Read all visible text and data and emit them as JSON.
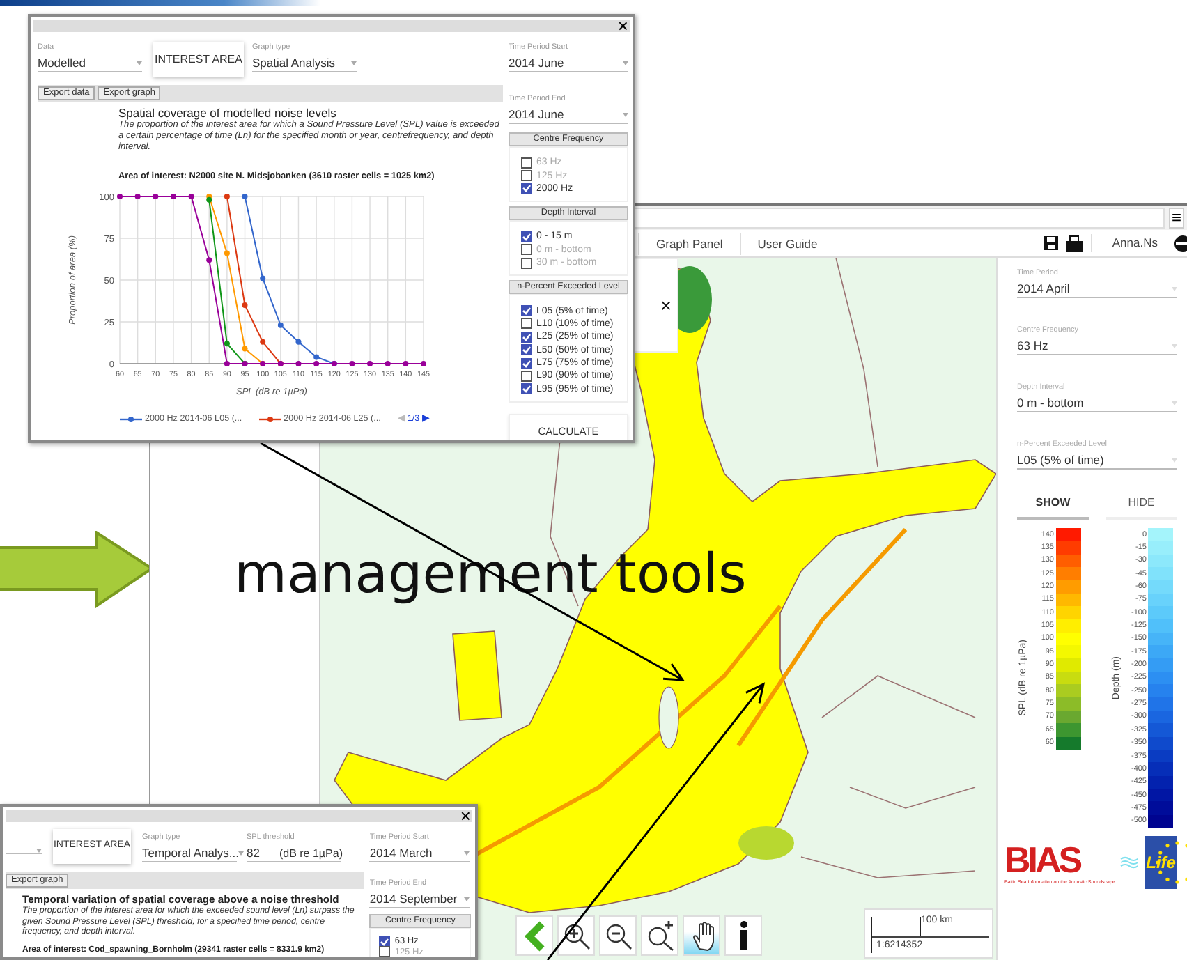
{
  "slide": {
    "headline": "management tools"
  },
  "map_app": {
    "menu_icon": "≡",
    "nav": [
      "Graph Panel",
      "User Guide"
    ],
    "user": "Anna.Ns",
    "info_panel": {
      "close": "×"
    },
    "settings": [
      {
        "label": "Time Period",
        "value": "2014 April"
      },
      {
        "label": "Centre Frequency",
        "value": "63 Hz"
      },
      {
        "label": "Depth Interval",
        "value": "0 m - bottom"
      },
      {
        "label": "n-Percent Exceeded Level",
        "value": "L05 (5% of time)"
      }
    ],
    "layer_tabs": [
      {
        "label": "SHOW",
        "selected": true
      },
      {
        "label": "HIDE",
        "selected": false
      }
    ],
    "spl_legend": {
      "axis_label": "SPL (dB re 1µPa)",
      "items": [
        {
          "label": "140",
          "color": "#ff1a00"
        },
        {
          "label": "135",
          "color": "#ff3c00"
        },
        {
          "label": "130",
          "color": "#ff5e00"
        },
        {
          "label": "125",
          "color": "#ff7e00"
        },
        {
          "label": "120",
          "color": "#ff9c00"
        },
        {
          "label": "115",
          "color": "#ffb800"
        },
        {
          "label": "110",
          "color": "#ffd400"
        },
        {
          "label": "105",
          "color": "#ffee00"
        },
        {
          "label": "100",
          "color": "#ffff00"
        },
        {
          "label": "95",
          "color": "#f4f800"
        },
        {
          "label": "90",
          "color": "#e0ea00"
        },
        {
          "label": "85",
          "color": "#c8dc10"
        },
        {
          "label": "80",
          "color": "#aacc20"
        },
        {
          "label": "75",
          "color": "#8cbc28"
        },
        {
          "label": "70",
          "color": "#6aa830"
        },
        {
          "label": "65",
          "color": "#3d9630"
        },
        {
          "label": "60",
          "color": "#157a2c"
        }
      ]
    },
    "depth_legend": {
      "axis_label": "Depth (m)",
      "items": [
        {
          "label": "0",
          "color": "#a4f4fb"
        },
        {
          "label": "-15",
          "color": "#98eefb"
        },
        {
          "label": "-30",
          "color": "#8ce8fb"
        },
        {
          "label": "-45",
          "color": "#80e2fb"
        },
        {
          "label": "-60",
          "color": "#74dafb"
        },
        {
          "label": "-75",
          "color": "#68d2fb"
        },
        {
          "label": "-100",
          "color": "#5ccafa"
        },
        {
          "label": "-125",
          "color": "#50c0fa"
        },
        {
          "label": "-150",
          "color": "#46b4f8"
        },
        {
          "label": "-175",
          "color": "#3ca8f6"
        },
        {
          "label": "-200",
          "color": "#349cf4"
        },
        {
          "label": "-225",
          "color": "#2c8ff2"
        },
        {
          "label": "-250",
          "color": "#2682ee"
        },
        {
          "label": "-275",
          "color": "#2074e8"
        },
        {
          "label": "-300",
          "color": "#1a66e0"
        },
        {
          "label": "-325",
          "color": "#1458d6"
        },
        {
          "label": "-350",
          "color": "#0f4acc"
        },
        {
          "label": "-375",
          "color": "#0a3cc2"
        },
        {
          "label": "-400",
          "color": "#062eb8"
        },
        {
          "label": "-425",
          "color": "#0322ae"
        },
        {
          "label": "-450",
          "color": "#0116a4"
        },
        {
          "label": "-475",
          "color": "#000c9a"
        },
        {
          "label": "-500",
          "color": "#000490"
        }
      ]
    },
    "map_tools": [
      {
        "kind": "back",
        "selected": false
      },
      {
        "kind": "zoom_in",
        "selected": false
      },
      {
        "kind": "zoom_out",
        "selected": false
      },
      {
        "kind": "zoom_extent",
        "selected": false
      },
      {
        "kind": "pan",
        "selected": true
      },
      {
        "kind": "info",
        "selected": false
      }
    ],
    "scale": {
      "distance": "100 km",
      "ratio": "1:6214352"
    },
    "logos": {
      "bias": "BIAS",
      "bias_subtitle": "Baltic Sea Information on the Acoustic Soundscape",
      "life": "Life"
    }
  },
  "spatial_dialog": {
    "close": "×",
    "data_field": {
      "label": "Data",
      "value": "Modelled"
    },
    "interest_button": "INTEREST AREA",
    "graph_type": {
      "label": "Graph type",
      "value": "Spatial Analysis"
    },
    "period_start": {
      "label": "Time Period Start",
      "value": "2014 June"
    },
    "period_end": {
      "label": "Time Period End",
      "value": "2014 June"
    },
    "export_buttons": [
      "Export data",
      "Export graph"
    ],
    "title": "Spatial coverage of modelled noise levels",
    "description": "The proportion of the interest area for which a Sound Pressure Level (SPL) value is exceeded a certain percentage of time (Ln) for the specified month or year, centrefrequency, and depth interval.",
    "area": "Area of interest: N2000 site N. Midsjobanken (3610 raster cells =  1025 km2)",
    "chart_data": {
      "type": "line",
      "grid": true,
      "xlim": [
        60,
        145
      ],
      "xlabel": "SPL (dB re 1µPa)",
      "ylabel": "Proportion of area (%)",
      "x": [
        60,
        65,
        70,
        75,
        80,
        85,
        90,
        95,
        100,
        105,
        110,
        115,
        120,
        125,
        130,
        135,
        140,
        145
      ],
      "xticks": [
        60,
        65,
        70,
        75,
        80,
        85,
        90,
        95,
        100,
        105,
        110,
        115,
        120,
        125,
        130,
        135,
        140,
        145
      ],
      "yticks": [
        0,
        25,
        50,
        75,
        100
      ],
      "ylim": [
        0,
        100
      ],
      "series": [
        {
          "name": "2000 Hz 2014-06 L05 (...",
          "color": "#3366cc",
          "marker": "circle",
          "values": [
            null,
            null,
            null,
            null,
            null,
            null,
            null,
            100,
            51,
            23,
            13,
            4,
            0,
            null,
            null,
            null,
            null,
            null
          ]
        },
        {
          "name": "2000 Hz 2014-06 L25 (...",
          "color": "#dc3912",
          "marker": "circle",
          "values": [
            null,
            null,
            null,
            null,
            null,
            null,
            100,
            35,
            13,
            0,
            null,
            null,
            null,
            null,
            null,
            null,
            null,
            null
          ]
        },
        {
          "color": "#ff9900",
          "marker": "circle",
          "values": [
            null,
            null,
            null,
            null,
            null,
            100,
            66,
            9,
            0,
            null,
            null,
            null,
            null,
            null,
            null,
            null,
            null,
            null
          ]
        },
        {
          "color": "#109618",
          "marker": "circle",
          "values": [
            null,
            null,
            null,
            null,
            null,
            98,
            12,
            0,
            null,
            null,
            null,
            null,
            null,
            null,
            null,
            null,
            null,
            null
          ]
        },
        {
          "color": "#990099",
          "marker": "circle",
          "values": [
            100,
            100,
            100,
            100,
            100,
            62,
            0,
            0,
            0,
            0,
            0,
            0,
            0,
            0,
            0,
            0,
            0,
            0
          ]
        }
      ]
    },
    "legend_pager": {
      "previous": {
        "label": "◀",
        "disabled": true
      },
      "page": "1/3",
      "next": {
        "label": "▶",
        "disabled": false
      }
    },
    "groups": [
      {
        "header": "Centre Frequency",
        "options": [
          {
            "label": "63 Hz",
            "checked": false,
            "disabled": true
          },
          {
            "label": "125 Hz",
            "checked": false,
            "disabled": true
          },
          {
            "label": "2000 Hz",
            "checked": true,
            "disabled": false
          }
        ]
      },
      {
        "header": "Depth Interval",
        "options": [
          {
            "label": "0 - 15 m",
            "checked": true,
            "disabled": false
          },
          {
            "label": "0 m - bottom",
            "checked": false,
            "disabled": true
          },
          {
            "label": "30 m - bottom",
            "checked": false,
            "disabled": true
          }
        ]
      },
      {
        "header": "n-Percent Exceeded Level",
        "options": [
          {
            "label": "L05 (5% of time)",
            "checked": true,
            "disabled": false
          },
          {
            "label": "L10 (10% of time)",
            "checked": false,
            "disabled": false
          },
          {
            "label": "L25 (25% of time)",
            "checked": true,
            "disabled": false
          },
          {
            "label": "L50 (50% of time)",
            "checked": true,
            "disabled": false
          },
          {
            "label": "L75 (75% of time)",
            "checked": true,
            "disabled": false
          },
          {
            "label": "L90 (90% of time)",
            "checked": false,
            "disabled": false
          },
          {
            "label": "L95 (95% of time)",
            "checked": true,
            "disabled": false
          }
        ]
      }
    ],
    "calculate": "CALCULATE"
  },
  "temporal_dialog": {
    "close": "×",
    "interest_button": "INTEREST AREA",
    "graph_type": {
      "label": "Graph type",
      "value": "Temporal Analys..."
    },
    "threshold": {
      "label": "SPL threshold",
      "value": "82",
      "unit": "(dB re 1µPa)"
    },
    "period_start": {
      "label": "Time Period Start",
      "value": "2014 March"
    },
    "period_end": {
      "label": "Time Period End",
      "value": "2014 September"
    },
    "export_buttons": [
      "Export graph"
    ],
    "title": "Temporal variation of spatial coverage above a noise threshold",
    "description": "The proportion of the interest area for which the exceeded sound level (Ln) surpass the given Sound Pressure Level (SPL) threshold, for a specified time period, centre frequency, and depth interval.",
    "area": "Area of interest: Cod_spawning_Bornholm (29341 raster cells = 8331.9 km2)",
    "groups": [
      {
        "header": "Centre Frequency",
        "options": [
          {
            "label": "63 Hz",
            "checked": true,
            "disabled": false
          },
          {
            "label": "125 Hz",
            "checked": false,
            "disabled": true
          }
        ]
      }
    ]
  }
}
